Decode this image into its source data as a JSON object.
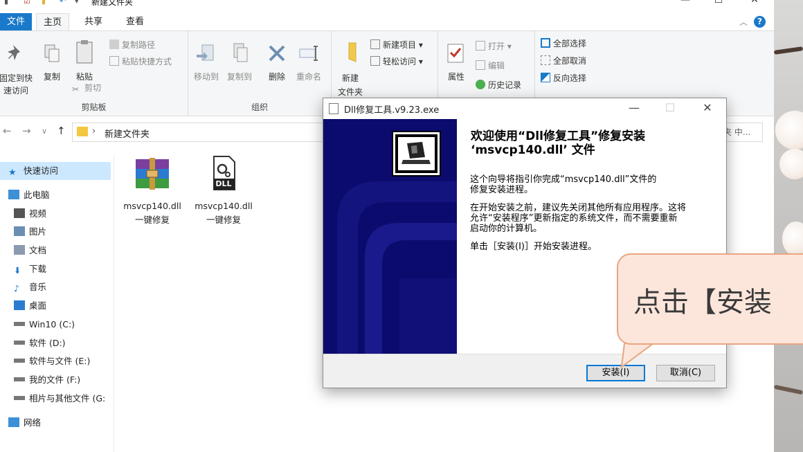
{
  "window": {
    "title": "新建文件夹",
    "controls": {
      "minimize": "—",
      "maximize": "☐",
      "close": "✕"
    }
  },
  "ribbon": {
    "tabs": [
      "文件",
      "主页",
      "共享",
      "查看"
    ],
    "active_tab": "主页",
    "groups": {
      "clipboard": {
        "label": "剪贴板",
        "pin_to_quick_access": [
          "固定到快",
          "速访问"
        ],
        "copy": "复制",
        "paste": "粘贴",
        "copy_path": "复制路径",
        "paste_shortcut": "粘贴快捷方式",
        "cut": "剪切"
      },
      "organize": {
        "label": "组织",
        "move_to": "移动到",
        "copy_to": "复制到",
        "delete": "删除",
        "rename": "重命名"
      },
      "new": {
        "new_folder": [
          "新建",
          "文件夹"
        ],
        "new_item": "新建项目",
        "easy_access": "轻松访问"
      },
      "open": {
        "properties": "属性",
        "open": "打开",
        "edit": "编辑",
        "history": "历史记录"
      },
      "select": {
        "select_all": "全部选择",
        "select_none": "全部取消",
        "invert": "反向选择"
      }
    }
  },
  "address": {
    "path": "新建文件夹",
    "search_placeholder": "夹 中..."
  },
  "navpane": {
    "items": [
      {
        "label": "快速访问",
        "icon": "star-icon",
        "selected": true
      },
      {
        "label": "此电脑",
        "icon": "computer-icon"
      },
      {
        "label": "视频",
        "icon": "video-icon"
      },
      {
        "label": "图片",
        "icon": "picture-icon"
      },
      {
        "label": "文档",
        "icon": "document-icon"
      },
      {
        "label": "下载",
        "icon": "download-icon"
      },
      {
        "label": "音乐",
        "icon": "music-icon"
      },
      {
        "label": "桌面",
        "icon": "desktop-icon"
      },
      {
        "label": "Win10 (C:)",
        "icon": "drive-icon"
      },
      {
        "label": "软件 (D:)",
        "icon": "drive-icon"
      },
      {
        "label": "软件与文件 (E:)",
        "icon": "drive-icon"
      },
      {
        "label": "我的文件 (F:)",
        "icon": "drive-icon"
      },
      {
        "label": "相片与其他文件 (G:",
        "icon": "drive-icon"
      },
      {
        "label": "网络",
        "icon": "network-icon"
      }
    ]
  },
  "files": [
    {
      "name_line1": "msvcp140.dll",
      "name_line2": "一键修复",
      "icon": "winrar-archive-icon"
    },
    {
      "name_line1": "msvcp140.dll",
      "name_line2": "一键修复",
      "icon": "dll-file-icon",
      "icon_text": "DLL"
    }
  ],
  "dialog": {
    "title": "Dll修复工具.v9.23.exe",
    "heading_line1": "欢迎使用“Dll修复工具”修复安装",
    "heading_line2": "‘msvcp140.dll’ 文件",
    "para1_line1": "这个向导将指引你完成“msvcp140.dll”文件的",
    "para1_line2": "修复安装进程。",
    "para2_line1": "在开始安装之前，建议先关闭其他所有应用程序。这将",
    "para2_line2": "允许“安装程序”更新指定的系统文件，而不需要重新",
    "para2_line3": "启动你的计算机。",
    "para3": "单击［安装(I)］开始安装进程。",
    "install_button": "安装(I)",
    "cancel_button": "取消(C)"
  },
  "callout": {
    "text": "点击【安装"
  },
  "colors": {
    "accent": "#1979ca",
    "banner": "#0a0a6a",
    "callout_fill": "#fce6dc",
    "callout_border": "#e9a57f",
    "nav_selected": "#cce8ff"
  }
}
